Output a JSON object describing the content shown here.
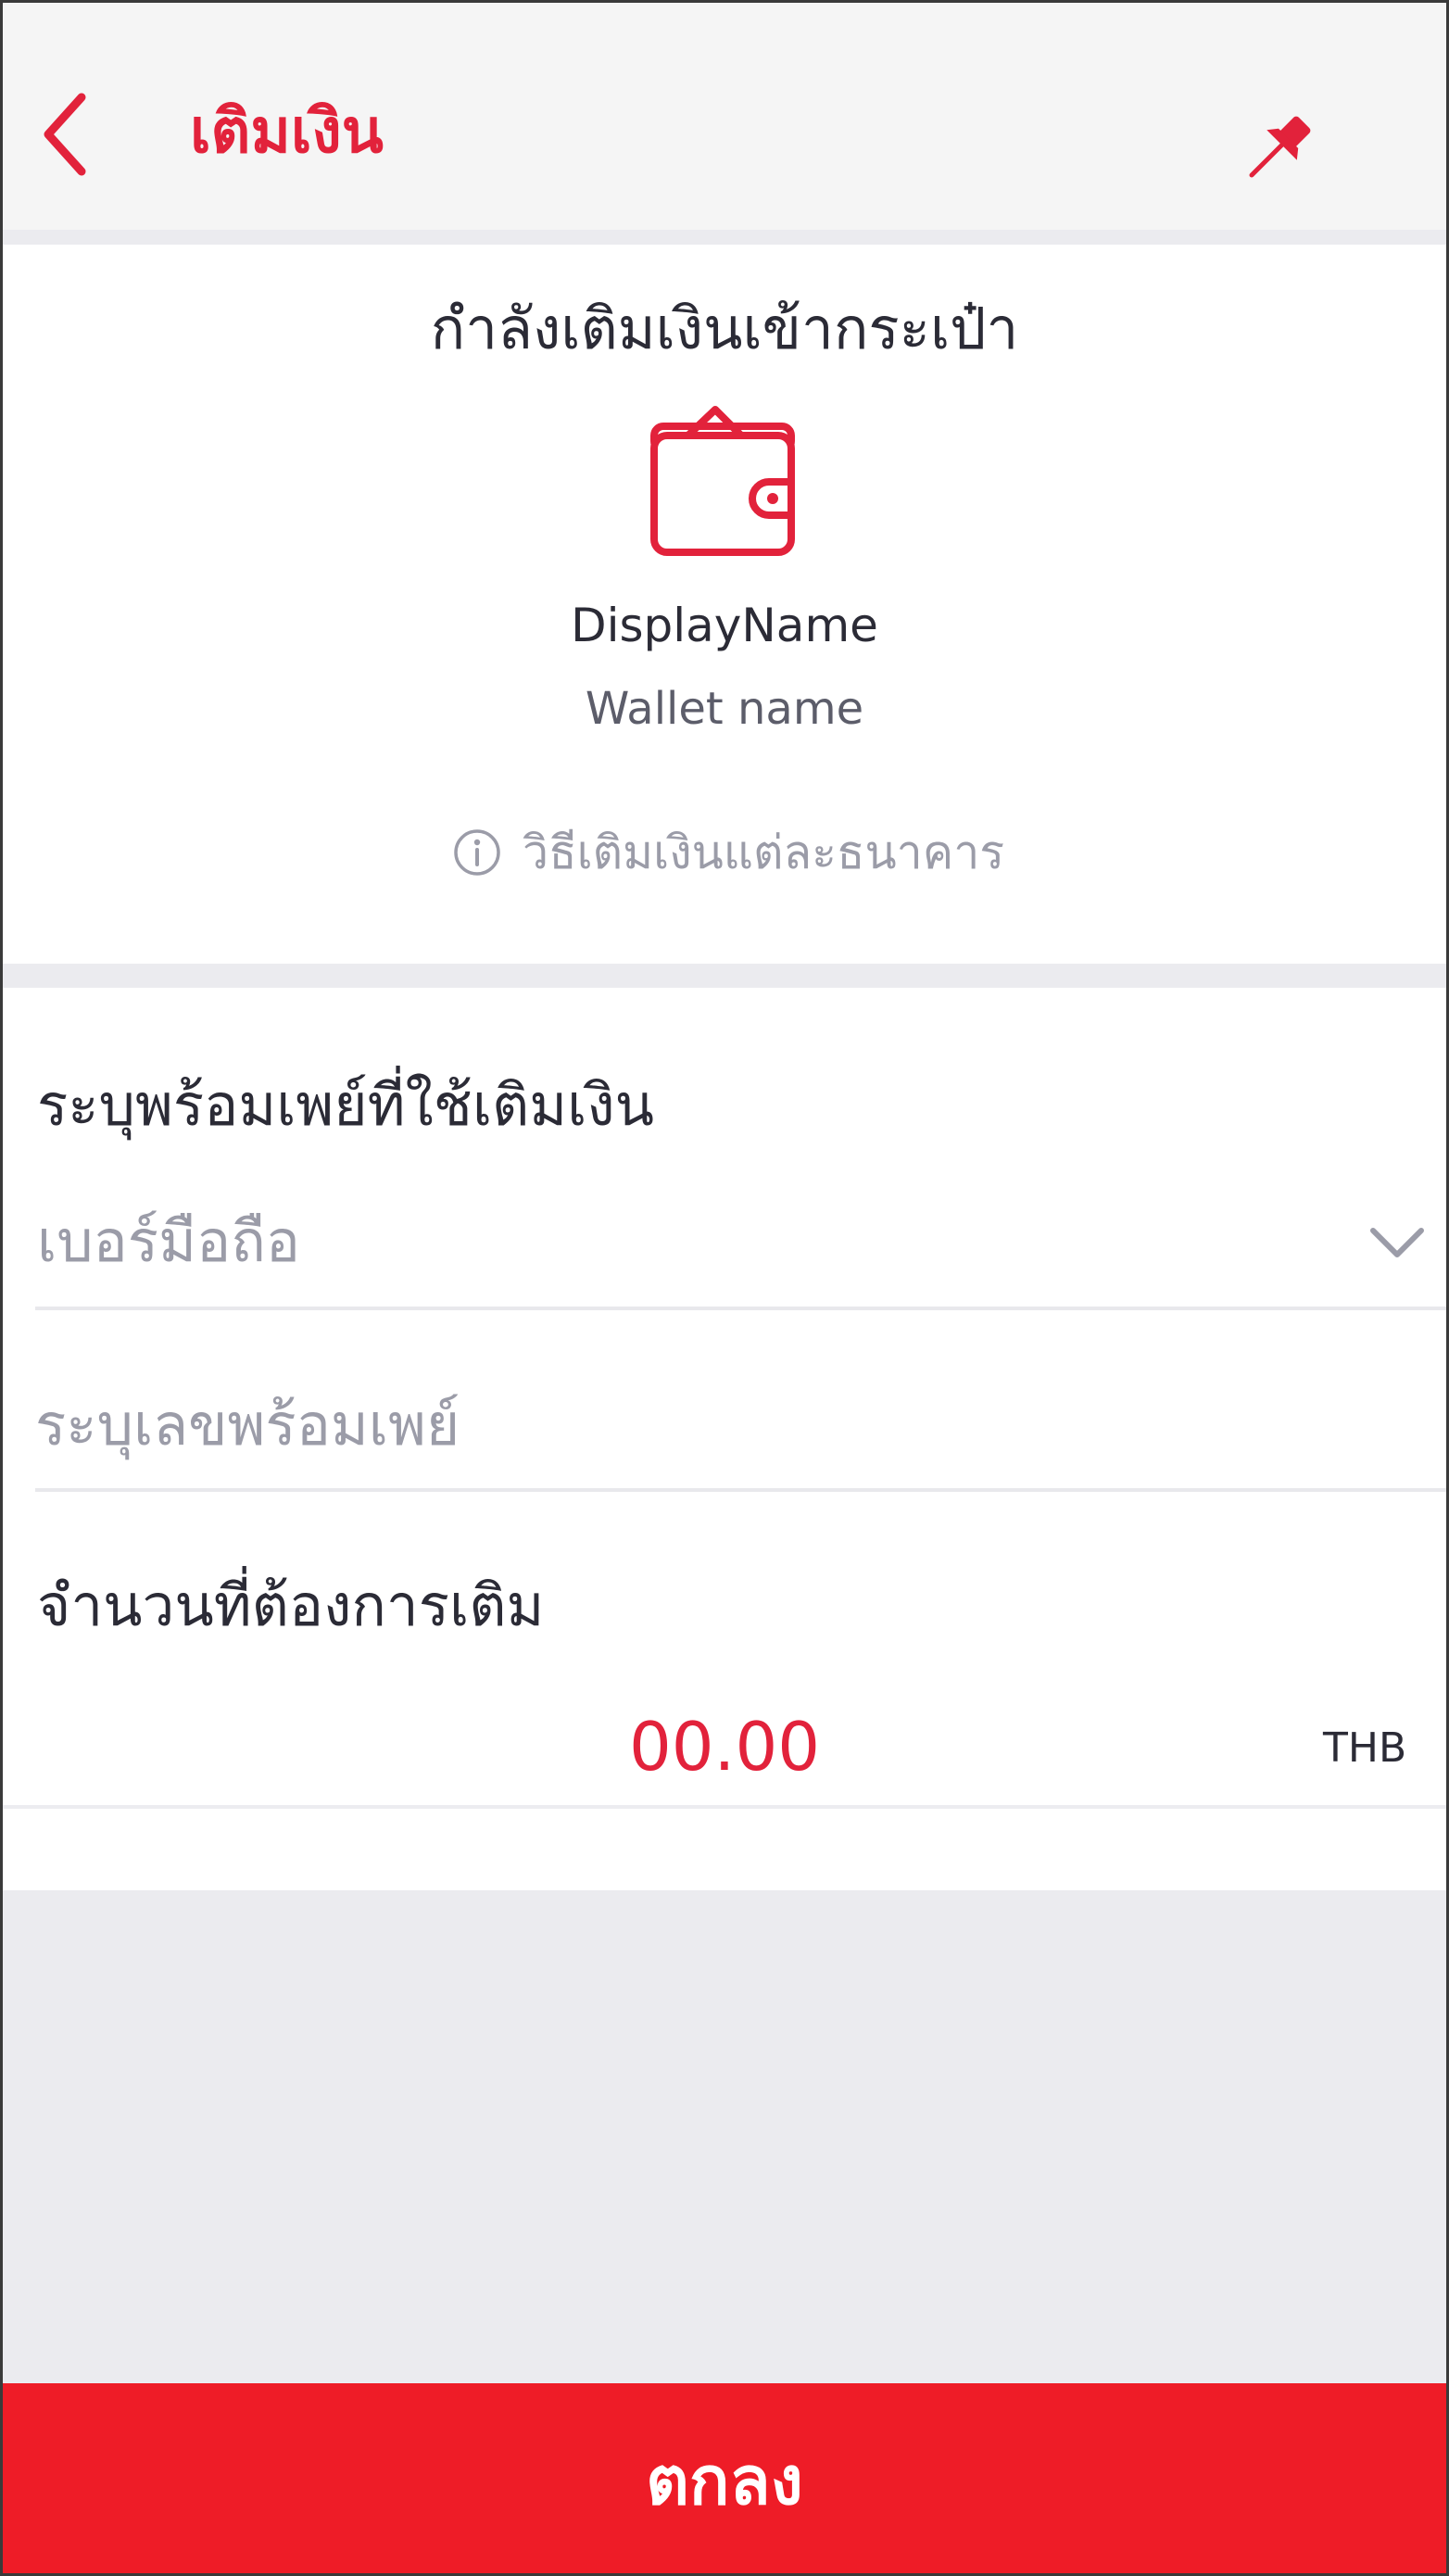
{
  "header": {
    "title": "เติมเงิน",
    "back_icon": "chevron-left-icon",
    "pin_icon": "pin-icon"
  },
  "wallet": {
    "heading": "กำลังเติมเงินเข้ากระเป๋า",
    "icon": "wallet-icon",
    "display_name": "DisplayName",
    "wallet_name": "Wallet name",
    "howto_label": "วิธีเติมเงินแต่ละธนาคาร",
    "howto_icon": "info-icon"
  },
  "form": {
    "promptpay_label": "ระบุพร้อมเพย์ที่ใช้เติมเงิน",
    "promptpay_type_value": "เบอร์มือถือ",
    "promptpay_number_placeholder": "ระบุเลขพร้อมเพย์",
    "amount_label": "จำนวนที่ต้องการเติม",
    "amount_value": "00.00",
    "currency": "THB"
  },
  "footer": {
    "confirm_label": "ตกลง"
  },
  "colors": {
    "accent": "#e2223b",
    "button": "#ee1c27",
    "background": "#ebebef",
    "placeholder": "#9b9ca8"
  }
}
